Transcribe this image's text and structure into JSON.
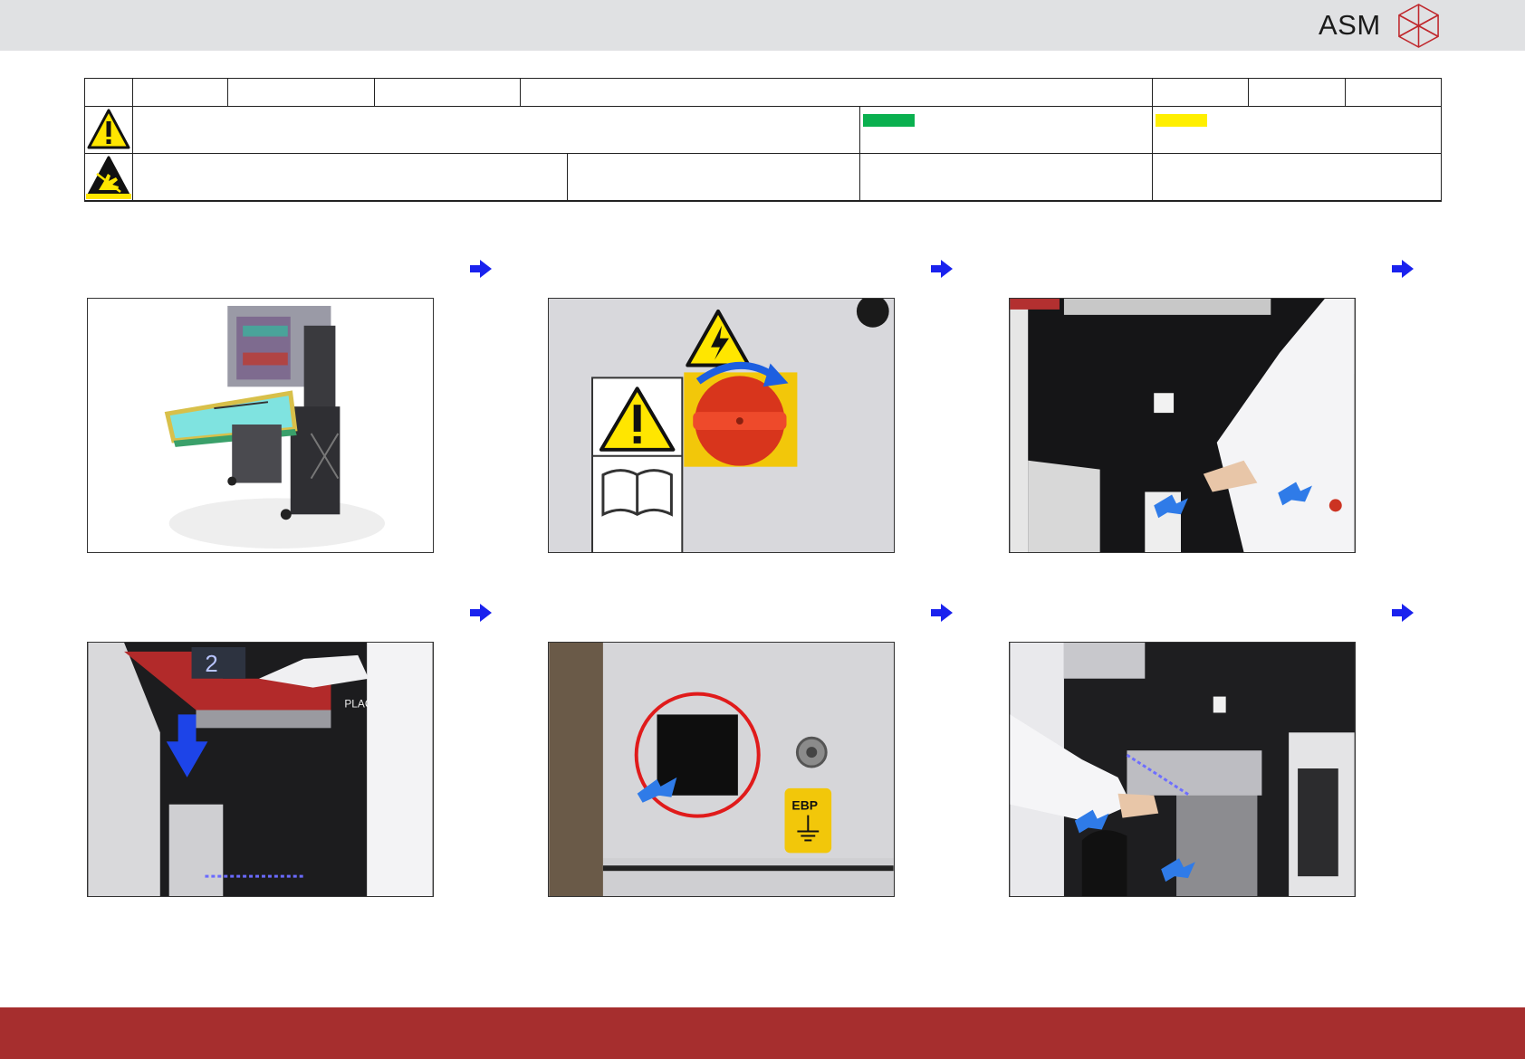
{
  "header": {
    "logo_text": "ASM",
    "colors": {
      "bar": "#e0e1e3",
      "logo_red": "#c0282d"
    }
  },
  "info_table": {
    "warning_icon": "warning-triangle-icon",
    "esd_icon": "esd-hand-icon",
    "status_colors": {
      "green": "#0ab04f",
      "yellow": "#ffef00"
    }
  },
  "steps": [
    {
      "image": "feeder-trolley-cad-render",
      "arrow_icon": "right-arrow-icon"
    },
    {
      "image": "main-power-switch-turn",
      "arrow_icon": "right-arrow-icon"
    },
    {
      "image": "operator-pulling-trolley-handles",
      "arrow_icon": "right-arrow-icon"
    },
    {
      "image": "lowering-front-cover",
      "arrow_icon": "right-arrow-icon"
    },
    {
      "image": "emergency-button-circled",
      "arrow_icon": "right-arrow-icon"
    },
    {
      "image": "inserting-trolley",
      "arrow_icon": "right-arrow-icon"
    }
  ],
  "photo_labels": {
    "ebp": "EBP",
    "cover_number": "2",
    "cover_brand": "PLACE"
  },
  "footer": {
    "color": "#a62e2e"
  }
}
